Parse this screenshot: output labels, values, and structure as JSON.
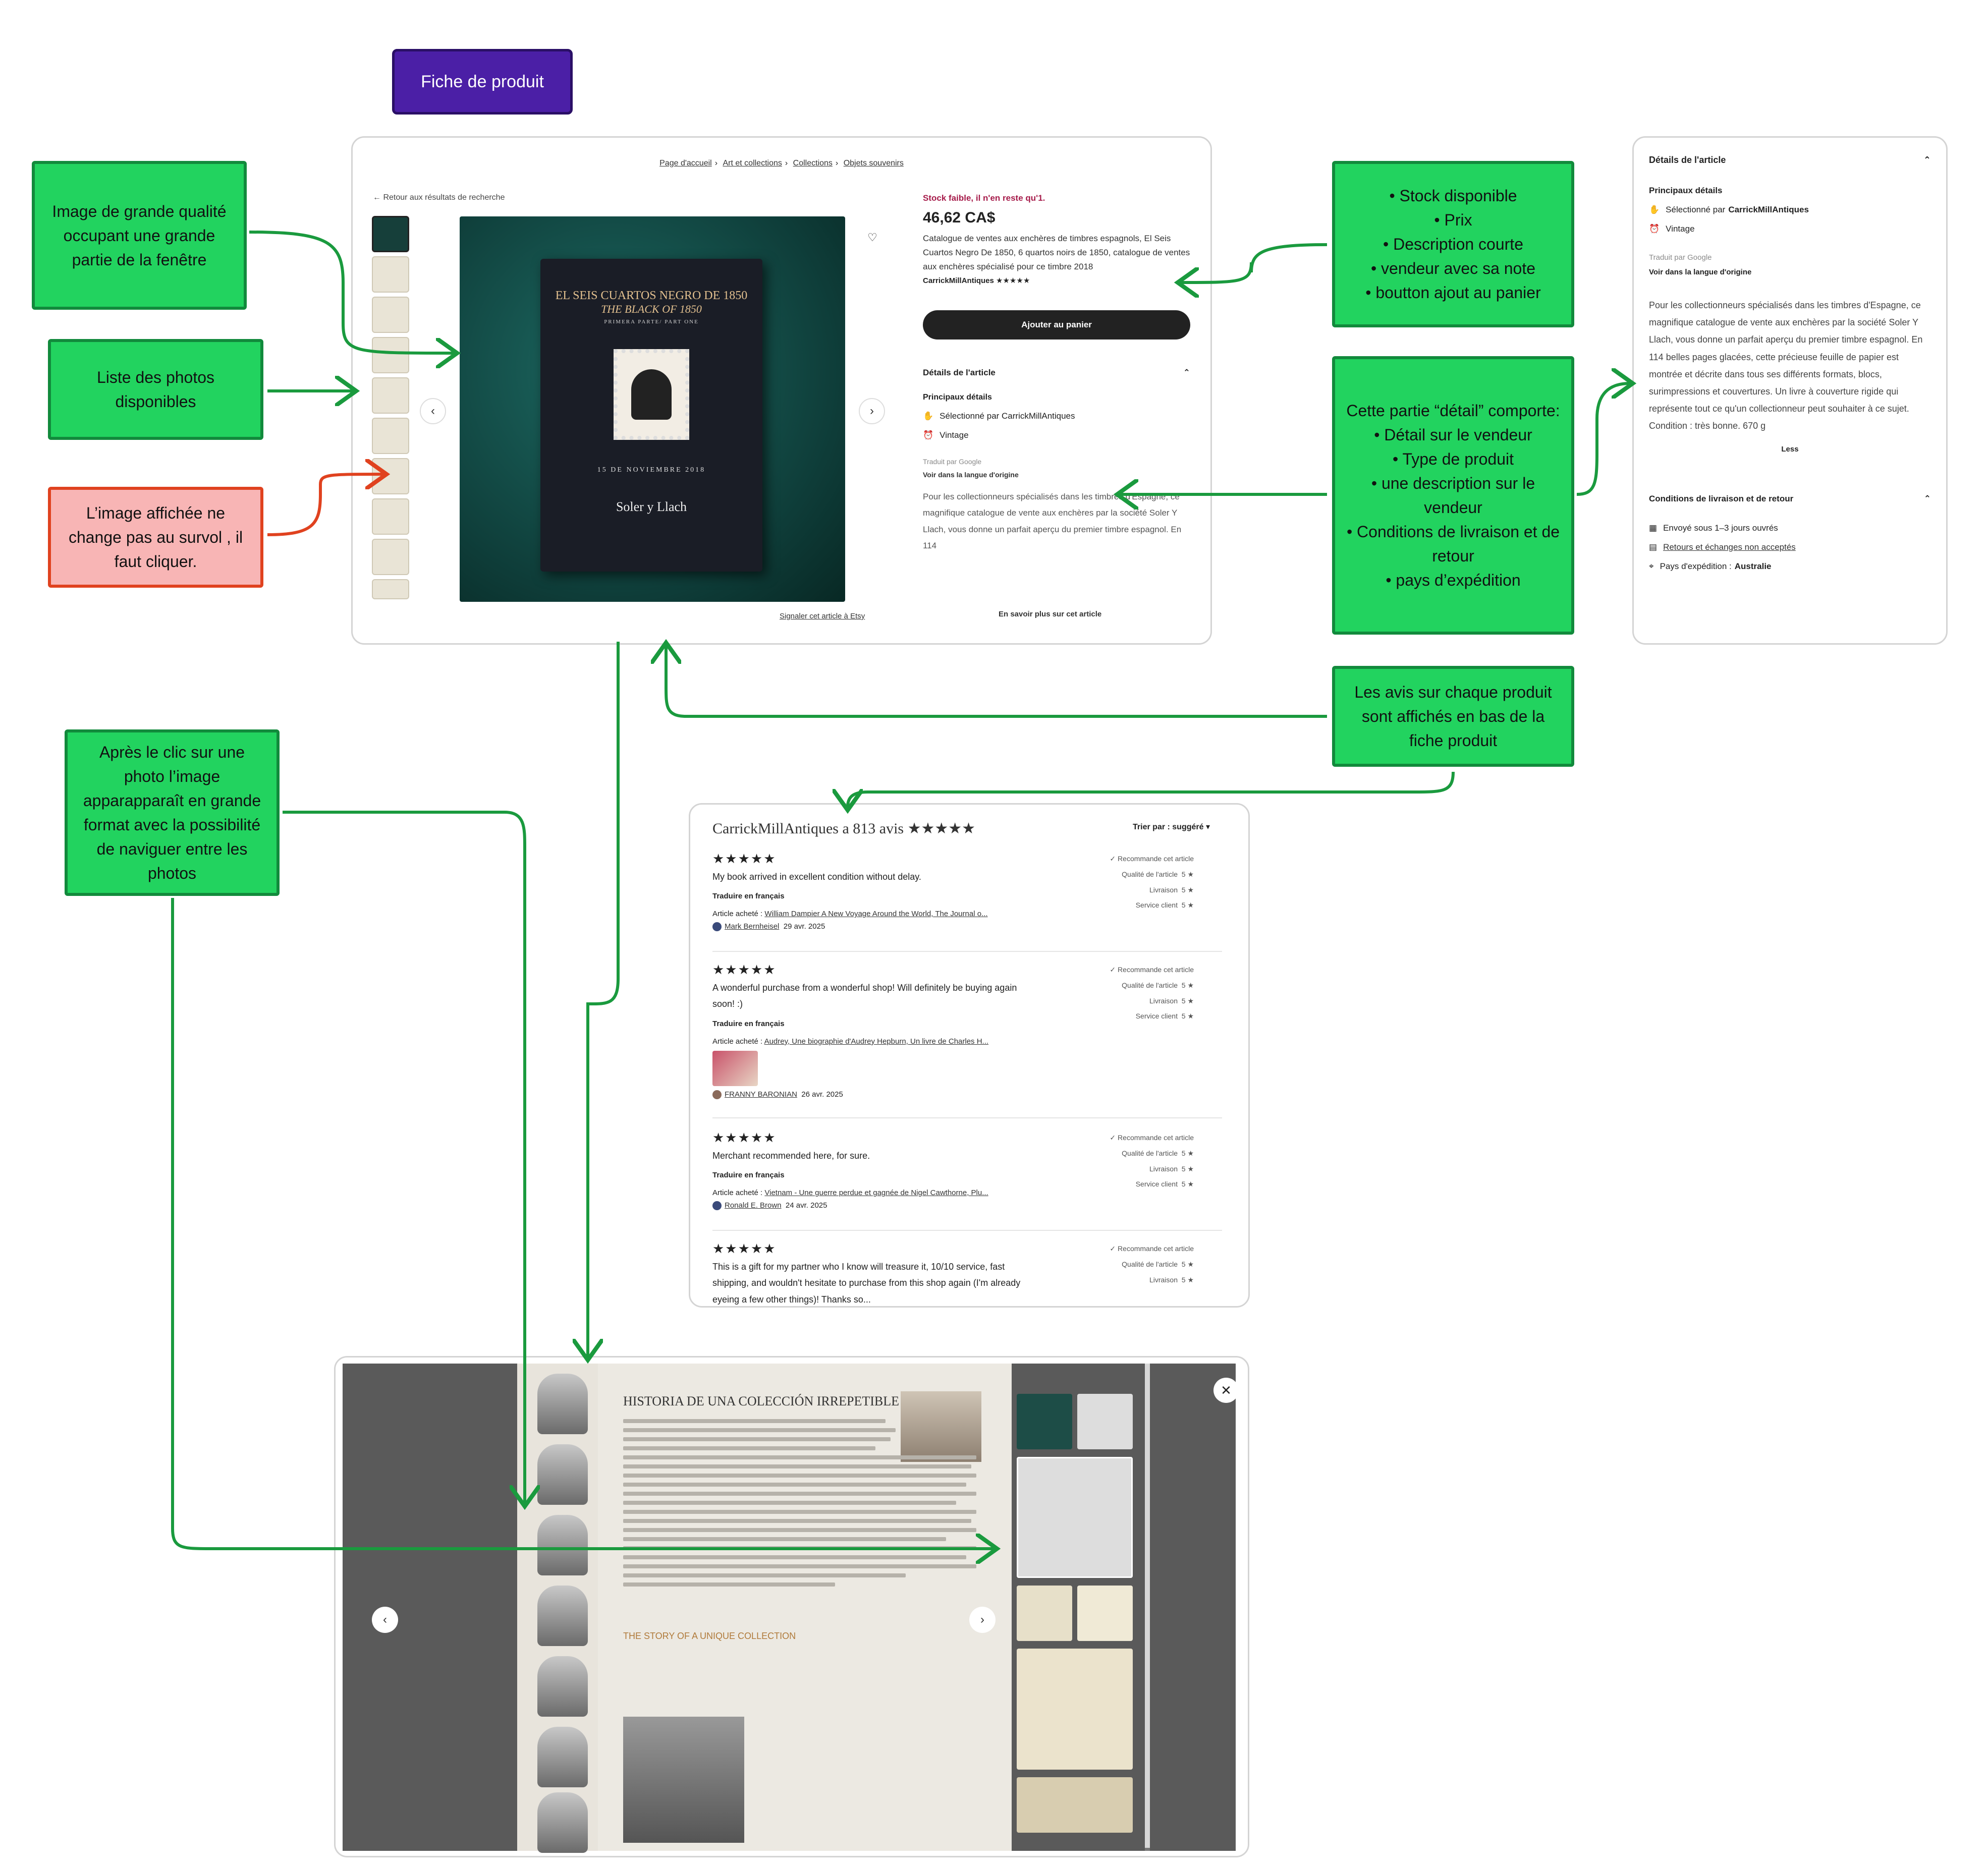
{
  "title": "Fiche de produit",
  "annotations": {
    "image_quality": "Image de grande qualité occupant une grande partie de la fenêtre",
    "photos_list": "Liste des photos disponibles",
    "hover_note": "L’image affichée ne change pas au survol , il faut cliquer.",
    "right_info_items": [
      "Stock disponible",
      "Prix",
      "Description courte",
      "vendeur avec sa note",
      "boutton ajout au panier"
    ],
    "detail_intro": "Cette partie “détail” comporte:",
    "detail_items": [
      "Détail sur le vendeur",
      "Type de produit",
      "une description sur le vendeur",
      "Conditions de livraison et de retour",
      "pays d’expédition"
    ],
    "reviews_note": "Les avis sur chaque produit sont affichés en bas de la fiche produit",
    "lightbox_note": "Après le clic sur une photo l’image apparapparaît en grande format avec la possibilité de naviguer entre les photos"
  },
  "product": {
    "breadcrumbs": [
      "Page d'accueil",
      "Art et collections",
      "Collections",
      "Objets souvenirs"
    ],
    "back_link": "← Retour aux résultats de recherche",
    "stock": "Stock faible, il n'en reste qu'1.",
    "price": "46,62 CA$",
    "description": "Catalogue de ventes aux enchères de timbres espagnols, El Seis Cuartos Negro De 1850, 6 quartos noirs de 1850, catalogue de ventes aux enchères spécialisé pour ce timbre 2018",
    "seller": "CarrickMillAntiques ★★★★★",
    "cart_button": "Ajouter au panier",
    "details_heading": "Détails de l'article",
    "main_details": "Principaux détails",
    "selected_by": "Sélectionné par CarrickMillAntiques",
    "vintage": "Vintage",
    "translated_by": "Traduit par Google",
    "original_lang": "Voir dans la langue d'origine",
    "long_description": "Pour les collectionneurs spécialisés dans les timbres d'Espagne, ce magnifique catalogue de vente aux enchères par la société Soler Y Llach, vous donne un parfait aperçu du premier timbre espagnol. En 114",
    "report_link": "Signaler cet article à Etsy",
    "learn_more": "En savoir plus sur cet article",
    "book": {
      "title1": "EL SEIS CUARTOS NEGRO DE 1850",
      "title2": "THE BLACK OF 1850",
      "part": "PRIMERA PARTE/ PART ONE",
      "date": "15 DE NOVIEMBRE 2018",
      "brand": "Soler y Llach"
    }
  },
  "detail_panel": {
    "heading": "Détails de l'article",
    "main_details": "Principaux détails",
    "selected_by_prefix": "Sélectionné par",
    "selected_by_name": "CarrickMillAntiques",
    "vintage": "Vintage",
    "translated_by": "Traduit par Google",
    "original_lang": "Voir dans la langue d'origine",
    "description": "Pour les collectionneurs spécialisés dans les timbres d'Espagne, ce magnifique catalogue de vente aux enchères par la société Soler Y Llach, vous donne un parfait aperçu du premier timbre espagnol. En 114 belles pages glacées, cette précieuse feuille de papier est montrée et décrite dans tous ses différents formats, blocs, surimpressions et couvertures. Un livre à couverture rigide qui représente tout ce qu'un collectionneur peut souhaiter à ce sujet. Condition : très bonne. 670 g",
    "less": "Less",
    "shipping_heading": "Conditions de livraison et de retour",
    "shipping_time": "Envoyé sous 1–3 jours ouvrés",
    "returns": "Retours et échanges non acceptés",
    "country_label": "Pays d'expédition :",
    "country": "Australie"
  },
  "reviews": {
    "heading": "CarrickMillAntiques a 813 avis ★★★★★",
    "sort": "Trier par : suggéré ▾",
    "recommends": "✓ Recommande cet article",
    "quality": "Qualité de l'article",
    "delivery": "Livraison",
    "service": "Service client",
    "score": "5 ★",
    "translate": "Traduire en français",
    "bought_label": "Article acheté :",
    "items": [
      {
        "stars": "★★★★★",
        "text": "My book arrived in excellent condition without delay.",
        "item": "William Dampier A New Voyage Around the World, The Journal o...",
        "author": "Mark Bernheisel",
        "date": "29 avr. 2025"
      },
      {
        "stars": "★★★★★",
        "text": "A wonderful purchase from a wonderful shop! Will definitely be buying again soon! :)",
        "item": "Audrey, Une biographie d'Audrey Hepburn, Un livre de Charles H...",
        "author": "FRANNY BARONIAN",
        "date": "26 avr. 2025"
      },
      {
        "stars": "★★★★★",
        "text": "Merchant recommended here, for sure.",
        "item": "Vietnam - Une guerre perdue et gagnée de Nigel Cawthorne, Plu...",
        "author": "Ronald E. Brown",
        "date": "24 avr. 2025"
      },
      {
        "stars": "★★★★★",
        "text": "This is a gift for my partner who I know will treasure it, 10/10 service, fast shipping, and wouldn't hesitate to purchase from this shop again (I'm already eyeing a few other things)! Thanks so..."
      }
    ]
  },
  "lightbox": {
    "doc_title": "HISTORIA DE UNA COLECCIÓN IRREPETIBLE",
    "sub_title": "THE STORY OF A UNIQUE COLLECTION",
    "close": "✕",
    "prev": "‹",
    "next": "›"
  },
  "colors": {
    "note_green": "#22d35f",
    "note_border": "#128a3c",
    "note_red": "#f8b5b5",
    "arrow_green": "#1a9a3e",
    "arrow_red": "#e0421f",
    "title_purple": "#4b1fa6"
  }
}
